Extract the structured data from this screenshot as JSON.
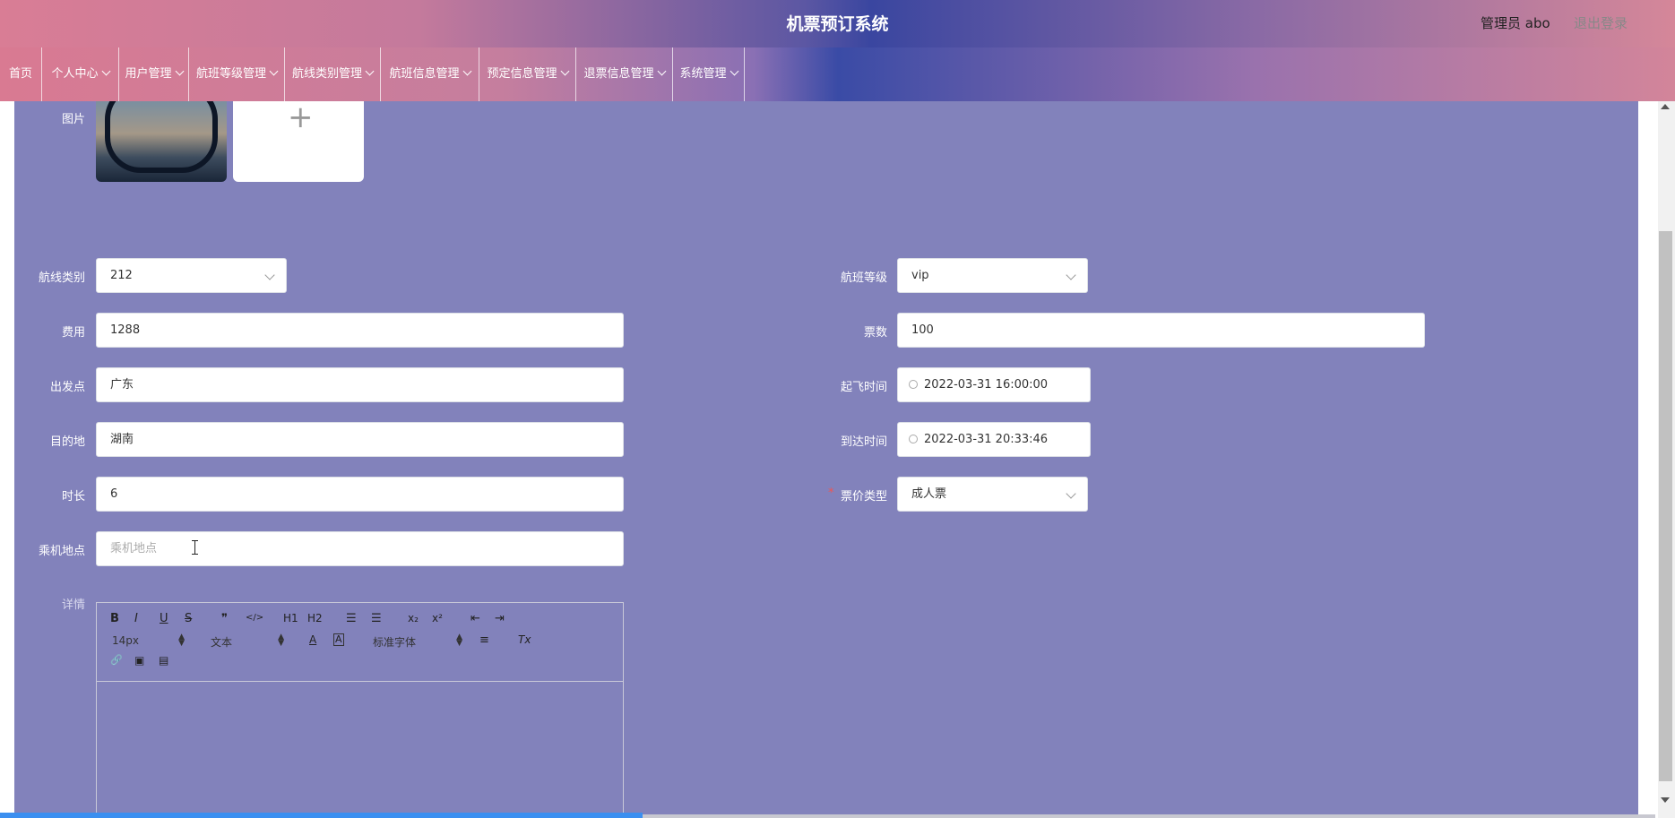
{
  "header": {
    "title": "机票预订系统",
    "user": "管理员 abo",
    "logout": "退出登录"
  },
  "nav": [
    {
      "label": "首页",
      "has_dropdown": false
    },
    {
      "label": "个人中心",
      "has_dropdown": true
    },
    {
      "label": "用户管理",
      "has_dropdown": true
    },
    {
      "label": "航班等级管理",
      "has_dropdown": true
    },
    {
      "label": "航线类别管理",
      "has_dropdown": true
    },
    {
      "label": "航班信息管理",
      "has_dropdown": true
    },
    {
      "label": "预定信息管理",
      "has_dropdown": true
    },
    {
      "label": "退票信息管理",
      "has_dropdown": true
    },
    {
      "label": "系统管理",
      "has_dropdown": true
    }
  ],
  "form": {
    "image_label": "图片",
    "upload_plus": "+",
    "route_category": {
      "label": "航线类别",
      "value": "212"
    },
    "flight_level": {
      "label": "航班等级",
      "value": "vip"
    },
    "fee": {
      "label": "费用",
      "value": "1288"
    },
    "ticket_count": {
      "label": "票数",
      "value": "100"
    },
    "departure": {
      "label": "出发点",
      "value": "广东"
    },
    "takeoff_time": {
      "label": "起飞时间",
      "value": "2022-03-31 16:00:00"
    },
    "destination": {
      "label": "目的地",
      "value": "湖南"
    },
    "arrival_time": {
      "label": "到达时间",
      "value": "2022-03-31 20:33:46"
    },
    "duration": {
      "label": "时长",
      "value": "6"
    },
    "ticket_type": {
      "label": "票价类型",
      "value": "成人票",
      "required_mark": "*"
    },
    "boarding_place": {
      "label": "乘机地点",
      "placeholder": "乘机地点"
    },
    "details_label": "详情"
  },
  "editor": {
    "font_size": "14px",
    "block_type": "文本",
    "font_family": "标准字体",
    "spin_up": "▲",
    "spin_down": "▼",
    "buttons": {
      "bold": "B",
      "italic": "I",
      "underline": "U",
      "strike": "S",
      "quote": "❞",
      "code": "</>",
      "h1": "H1",
      "h2": "H2",
      "ordered_list": "☰",
      "bullet_list": "☰",
      "subscript": "x₂",
      "superscript": "x²",
      "outdent": "⇤",
      "indent": "⇥",
      "font_color": "A",
      "bg_color": "A",
      "align": "≡",
      "clean": "Tx",
      "link": "🔗",
      "image": "▣",
      "video": "▤"
    }
  },
  "colors": {
    "content_bg": "#8282bb",
    "progress": "#3b8ff0"
  }
}
